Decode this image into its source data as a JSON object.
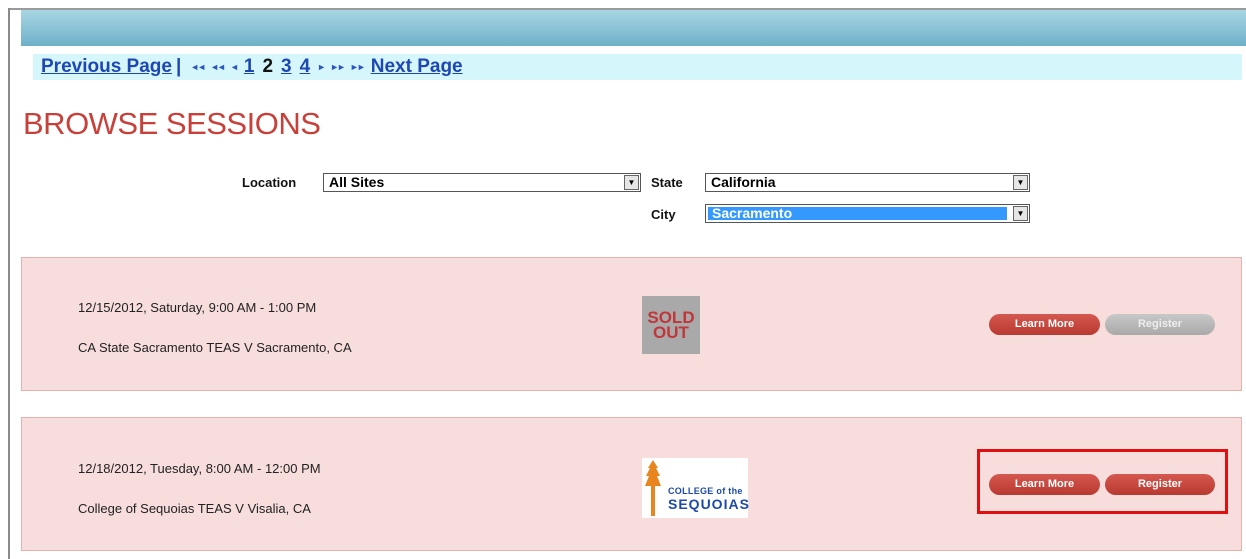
{
  "pager": {
    "previous": "Previous Page",
    "separator": "|",
    "first_glyph": "◄◄",
    "prev_fast_glyph": "◄◄",
    "prev_glyph": "◄",
    "pages": [
      "1",
      "2",
      "3",
      "4"
    ],
    "current": "2",
    "next_glyph": "►",
    "next_fast_glyph": "►►",
    "last_glyph": "►►",
    "next": "Next Page"
  },
  "title": "BROWSE SESSIONS",
  "filters": {
    "location_label": "Location",
    "location_value": "All Sites",
    "state_label": "State",
    "state_value": "California",
    "city_label": "City",
    "city_value": "Sacramento"
  },
  "sessions": [
    {
      "datetime": "12/15/2012, Saturday, 9:00 AM - 1:00 PM",
      "name": "CA State Sacramento TEAS V Sacramento, CA",
      "badge_line1": "SOLD",
      "badge_line2": "OUT",
      "learn_more": "Learn More",
      "register": "Register"
    },
    {
      "datetime": "12/18/2012, Tuesday, 8:00 AM - 12:00 PM",
      "name": "College of Sequoias TEAS V Visalia, CA",
      "logo_line1": "COLLEGE of the",
      "logo_line2": "SEQUOIAS",
      "learn_more": "Learn More",
      "register": "Register"
    }
  ],
  "colors": {
    "title": "#c8403a",
    "link": "#1f47b3",
    "session_bg": "#f7dddc",
    "button_red": "#c4453d",
    "button_disabled": "#b8b8b8",
    "highlight_box": "#e01010"
  }
}
